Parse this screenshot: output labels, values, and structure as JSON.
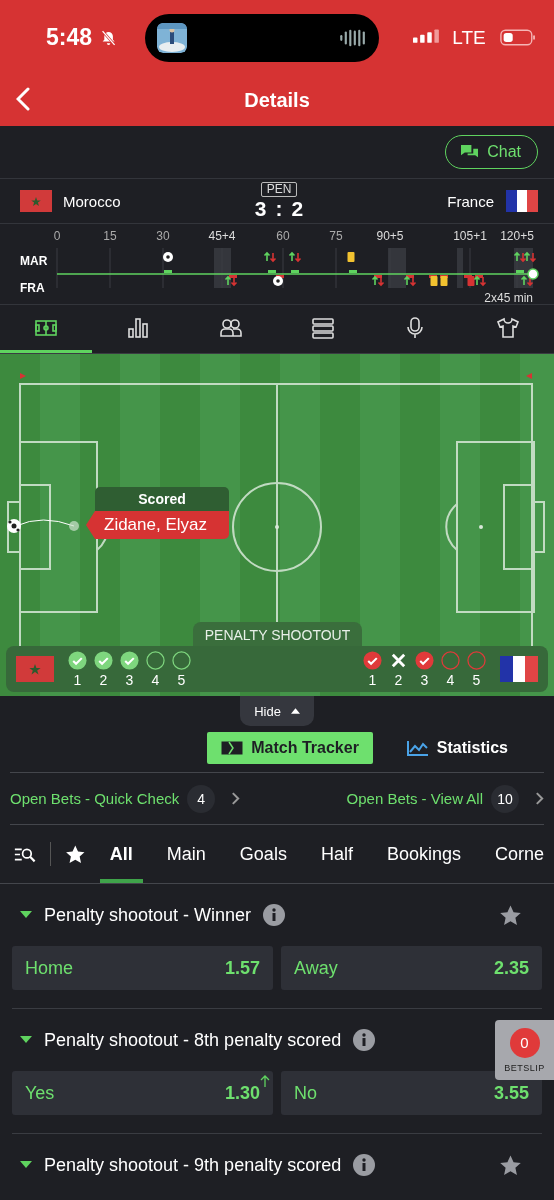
{
  "status": {
    "time": "5:48",
    "network": "LTE"
  },
  "nav": {
    "title": "Details"
  },
  "chat": "Chat",
  "match": {
    "home": "Morocco",
    "away": "France",
    "badge": "PEN",
    "score_home": "3",
    "separator": ":",
    "score_away": "2"
  },
  "timeline": {
    "home_code": "MAR",
    "away_code": "FRA",
    "format": "2x45 min",
    "ticks": [
      "0",
      "15",
      "30",
      "45+4",
      "60",
      "75",
      "90+5",
      "105+1",
      "120+5"
    ]
  },
  "views": [
    {
      "kind": "pitch",
      "selected": true
    },
    {
      "kind": "stats",
      "selected": false
    },
    {
      "kind": "lineups",
      "selected": false
    },
    {
      "kind": "table",
      "selected": false
    },
    {
      "kind": "commentary",
      "selected": false
    },
    {
      "kind": "kit",
      "selected": false
    }
  ],
  "pitch": {
    "event": {
      "title": "Scored",
      "player": "Zidane, Elyaz"
    }
  },
  "shootout": {
    "title": "PENALTY SHOOTOUT",
    "home": [
      {
        "number": "1",
        "kind": "scored"
      },
      {
        "number": "2",
        "kind": "scored"
      },
      {
        "number": "3",
        "kind": "scored"
      },
      {
        "number": "4",
        "kind": "pending"
      },
      {
        "number": "5",
        "kind": "pending"
      }
    ],
    "away": [
      {
        "number": "1",
        "kind": "scored"
      },
      {
        "number": "2",
        "kind": "missed"
      },
      {
        "number": "3",
        "kind": "scored"
      },
      {
        "number": "4",
        "kind": "pending"
      },
      {
        "number": "5",
        "kind": "pending"
      }
    ]
  },
  "hide": "Hide",
  "tracker_buttons": [
    {
      "label": "Match Tracker",
      "selected": true
    },
    {
      "label": "Statistics",
      "selected": false
    }
  ],
  "open_bets": [
    {
      "label": "Open Bets - Quick Check",
      "count": "4"
    },
    {
      "label": "Open Bets - View All",
      "count": "10"
    }
  ],
  "market_tabs": [
    {
      "label": "All",
      "selected": true
    },
    {
      "label": "Main",
      "selected": false
    },
    {
      "label": "Goals",
      "selected": false
    },
    {
      "label": "Half",
      "selected": false
    },
    {
      "label": "Bookings",
      "selected": false
    },
    {
      "label": "Corne",
      "selected": false
    }
  ],
  "markets": [
    {
      "title": "Penalty shootout - Winner",
      "options": [
        {
          "label": "Home",
          "odds": "1.57",
          "rising": false
        },
        {
          "label": "Away",
          "odds": "2.35",
          "rising": false
        }
      ]
    },
    {
      "title": "Penalty shootout - 8th penalty scored",
      "options": [
        {
          "label": "Yes",
          "odds": "1.30",
          "rising": true
        },
        {
          "label": "No",
          "odds": "3.55",
          "rising": false
        }
      ]
    },
    {
      "title": "Penalty shootout - 9th penalty scored"
    }
  ],
  "betslip": {
    "count": "0",
    "label": "BETSLIP"
  }
}
